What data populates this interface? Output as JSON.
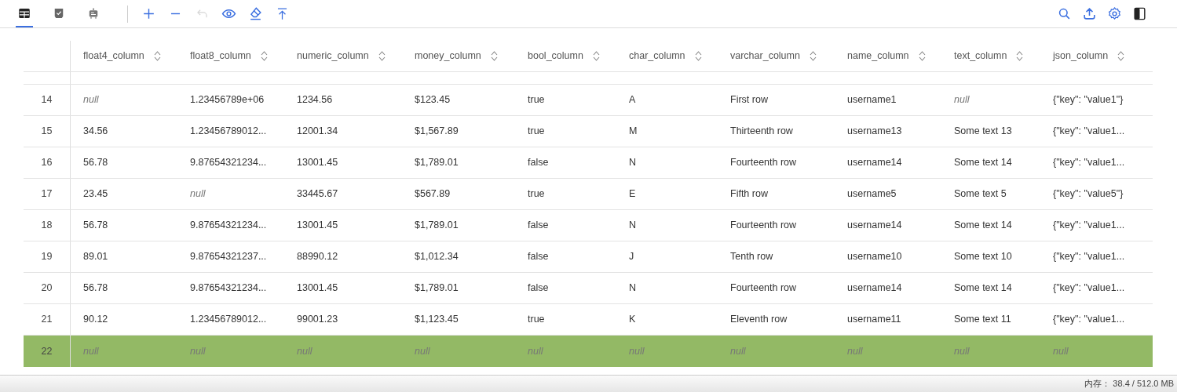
{
  "toolbar": {
    "views": [
      {
        "selected": true
      },
      {
        "selected": false
      },
      {
        "selected": false
      }
    ],
    "actions": [
      {
        "disabled": false
      },
      {
        "disabled": false
      },
      {
        "disabled": true
      },
      {
        "disabled": false
      },
      {
        "disabled": false
      },
      {
        "disabled": false
      }
    ]
  },
  "table": {
    "columns": [
      "float4_column",
      "float8_column",
      "numeric_column",
      "money_column",
      "bool_column",
      "char_column",
      "varchar_column",
      "name_column",
      "text_column",
      "json_column"
    ],
    "rows": [
      {
        "number": "14",
        "selected": false,
        "cells": [
          {
            "text": "null",
            "kind": "null"
          },
          {
            "text": "1.23456789e+06",
            "kind": "value"
          },
          {
            "text": "1234.56",
            "kind": "value"
          },
          {
            "text": "$123.45",
            "kind": "value"
          },
          {
            "text": "true",
            "kind": "value"
          },
          {
            "text": "A",
            "kind": "value"
          },
          {
            "text": "First row",
            "kind": "value"
          },
          {
            "text": "username1",
            "kind": "value"
          },
          {
            "text": "null",
            "kind": "null"
          },
          {
            "text": "{\"key\": \"value1\"}",
            "kind": "value"
          }
        ]
      },
      {
        "number": "15",
        "selected": false,
        "cells": [
          {
            "text": "34.56",
            "kind": "value"
          },
          {
            "text": "1.23456789012...",
            "kind": "value"
          },
          {
            "text": "12001.34",
            "kind": "value"
          },
          {
            "text": "$1,567.89",
            "kind": "value"
          },
          {
            "text": "true",
            "kind": "value"
          },
          {
            "text": "M",
            "kind": "value"
          },
          {
            "text": "Thirteenth row",
            "kind": "value"
          },
          {
            "text": "username13",
            "kind": "value"
          },
          {
            "text": "Some text 13",
            "kind": "value"
          },
          {
            "text": "{\"key\": \"value1...",
            "kind": "value"
          }
        ]
      },
      {
        "number": "16",
        "selected": false,
        "cells": [
          {
            "text": "56.78",
            "kind": "value"
          },
          {
            "text": "9.87654321234...",
            "kind": "value"
          },
          {
            "text": "13001.45",
            "kind": "value"
          },
          {
            "text": "$1,789.01",
            "kind": "value"
          },
          {
            "text": "false",
            "kind": "value"
          },
          {
            "text": "N",
            "kind": "value"
          },
          {
            "text": "Fourteenth row",
            "kind": "value"
          },
          {
            "text": "username14",
            "kind": "value"
          },
          {
            "text": "Some text 14",
            "kind": "value"
          },
          {
            "text": "{\"key\": \"value1...",
            "kind": "value"
          }
        ]
      },
      {
        "number": "17",
        "selected": false,
        "cells": [
          {
            "text": "23.45",
            "kind": "value"
          },
          {
            "text": "null",
            "kind": "null"
          },
          {
            "text": "33445.67",
            "kind": "value"
          },
          {
            "text": "$567.89",
            "kind": "value"
          },
          {
            "text": "true",
            "kind": "value"
          },
          {
            "text": "E",
            "kind": "value"
          },
          {
            "text": "Fifth row",
            "kind": "value"
          },
          {
            "text": "username5",
            "kind": "value"
          },
          {
            "text": "Some text 5",
            "kind": "value"
          },
          {
            "text": "{\"key\": \"value5\"}",
            "kind": "value"
          }
        ]
      },
      {
        "number": "18",
        "selected": false,
        "cells": [
          {
            "text": "56.78",
            "kind": "value"
          },
          {
            "text": "9.87654321234...",
            "kind": "value"
          },
          {
            "text": "13001.45",
            "kind": "value"
          },
          {
            "text": "$1,789.01",
            "kind": "value"
          },
          {
            "text": "false",
            "kind": "value"
          },
          {
            "text": "N",
            "kind": "value"
          },
          {
            "text": "Fourteenth row",
            "kind": "value"
          },
          {
            "text": "username14",
            "kind": "value"
          },
          {
            "text": "Some text 14",
            "kind": "value"
          },
          {
            "text": "{\"key\": \"value1...",
            "kind": "value"
          }
        ]
      },
      {
        "number": "19",
        "selected": false,
        "cells": [
          {
            "text": "89.01",
            "kind": "value"
          },
          {
            "text": "9.87654321237...",
            "kind": "value"
          },
          {
            "text": "88990.12",
            "kind": "value"
          },
          {
            "text": "$1,012.34",
            "kind": "value"
          },
          {
            "text": "false",
            "kind": "value"
          },
          {
            "text": "J",
            "kind": "value"
          },
          {
            "text": "Tenth row",
            "kind": "value"
          },
          {
            "text": "username10",
            "kind": "value"
          },
          {
            "text": "Some text 10",
            "kind": "value"
          },
          {
            "text": "{\"key\": \"value1...",
            "kind": "value"
          }
        ]
      },
      {
        "number": "20",
        "selected": false,
        "cells": [
          {
            "text": "56.78",
            "kind": "value"
          },
          {
            "text": "9.87654321234...",
            "kind": "value"
          },
          {
            "text": "13001.45",
            "kind": "value"
          },
          {
            "text": "$1,789.01",
            "kind": "value"
          },
          {
            "text": "false",
            "kind": "value"
          },
          {
            "text": "N",
            "kind": "value"
          },
          {
            "text": "Fourteenth row",
            "kind": "value"
          },
          {
            "text": "username14",
            "kind": "value"
          },
          {
            "text": "Some text 14",
            "kind": "value"
          },
          {
            "text": "{\"key\": \"value1...",
            "kind": "value"
          }
        ]
      },
      {
        "number": "21",
        "selected": false,
        "cells": [
          {
            "text": "90.12",
            "kind": "value"
          },
          {
            "text": "1.23456789012...",
            "kind": "value"
          },
          {
            "text": "99001.23",
            "kind": "value"
          },
          {
            "text": "$1,123.45",
            "kind": "value"
          },
          {
            "text": "true",
            "kind": "value"
          },
          {
            "text": "K",
            "kind": "value"
          },
          {
            "text": "Eleventh row",
            "kind": "value"
          },
          {
            "text": "username11",
            "kind": "value"
          },
          {
            "text": "Some text 11",
            "kind": "value"
          },
          {
            "text": "{\"key\": \"value1...",
            "kind": "value"
          }
        ]
      },
      {
        "number": "22",
        "selected": true,
        "cells": [
          {
            "text": "null",
            "kind": "null"
          },
          {
            "text": "null",
            "kind": "null"
          },
          {
            "text": "null",
            "kind": "null"
          },
          {
            "text": "null",
            "kind": "null"
          },
          {
            "text": "null",
            "kind": "null"
          },
          {
            "text": "null",
            "kind": "null"
          },
          {
            "text": "null",
            "kind": "null"
          },
          {
            "text": "null",
            "kind": "null"
          },
          {
            "text": "null",
            "kind": "null"
          },
          {
            "text": "null",
            "kind": "null"
          }
        ]
      }
    ]
  },
  "status_bar": {
    "memory": "内存： 38.4 / 512.0 MB"
  }
}
